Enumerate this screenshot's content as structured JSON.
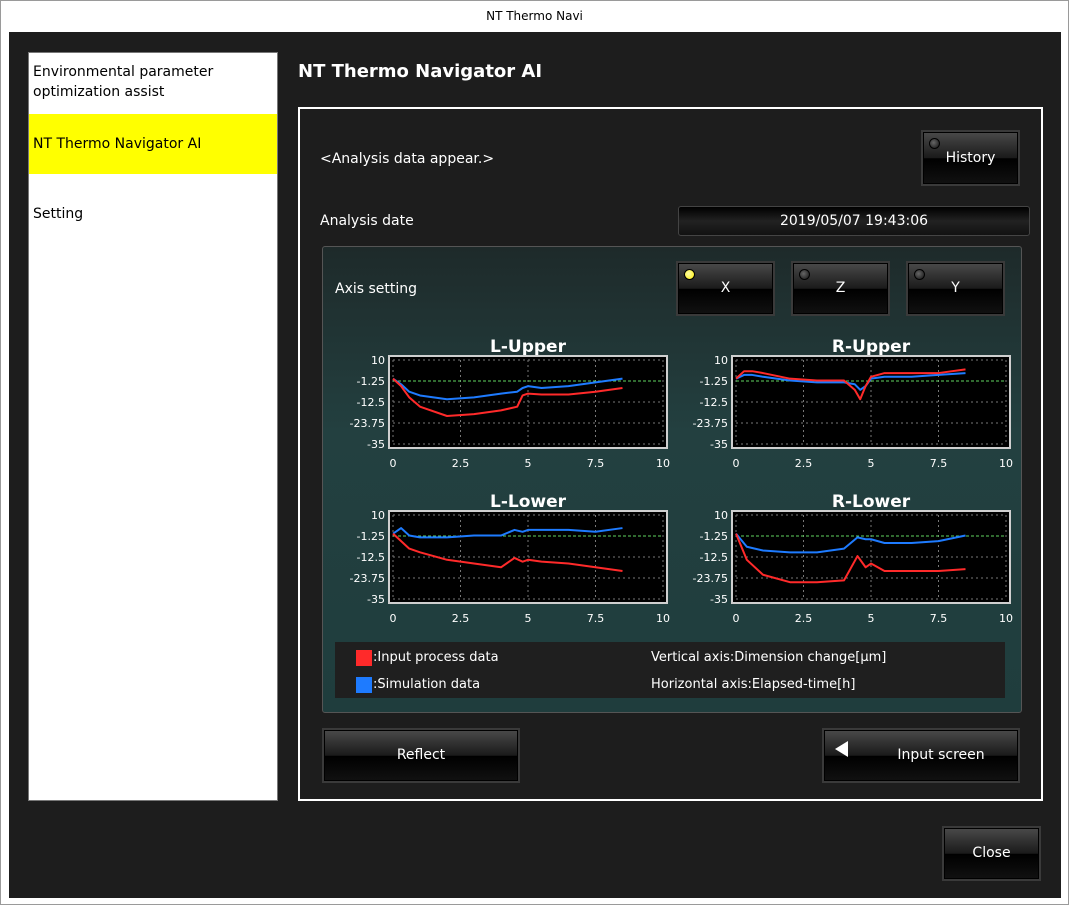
{
  "window": {
    "title": "NT Thermo Navi"
  },
  "sidebar": {
    "items": [
      {
        "label": "Environmental parameter optimization assist",
        "active": false
      },
      {
        "label": "NT Thermo Navigator AI",
        "active": true
      },
      {
        "label": "Setting",
        "active": false
      }
    ]
  },
  "main": {
    "title": "NT Thermo Navigator AI",
    "status_text": "<Analysis data appear.>",
    "history_button": "History",
    "analysis_date_label": "Analysis date",
    "analysis_date_value": "2019/05/07 19:43:06",
    "axis_setting_label": "Axis setting",
    "axis_buttons": [
      {
        "label": "X",
        "selected": true
      },
      {
        "label": "Z",
        "selected": false
      },
      {
        "label": "Y",
        "selected": false
      }
    ],
    "reflect_button": "Reflect",
    "input_screen_button": "Input screen"
  },
  "close_button": "Close",
  "legend": {
    "input_label": ":Input process data",
    "simulation_label": ":Simulation data",
    "vertical_axis": "Vertical axis:Dimension change[μm]",
    "horizontal_axis": "Horizontal axis:Elapsed-time[h]",
    "input_color": "#ff2a2a",
    "simulation_color": "#1e7bff"
  },
  "chart_data": [
    {
      "type": "line",
      "title": "L-Upper",
      "xlim": [
        0,
        10
      ],
      "ylim": [
        -35,
        10
      ],
      "xticks": [
        "0",
        "2.5",
        "5",
        "7.5",
        "10"
      ],
      "yticks": [
        "10",
        "-1.25",
        "-12.5",
        "-23.75",
        "-35"
      ],
      "reference_y": -1.25,
      "grid": true,
      "series": [
        {
          "name": "Input process data",
          "color": "#ff2a2a",
          "x": [
            0,
            0.3,
            0.6,
            1,
            2,
            3,
            4,
            4.6,
            4.8,
            5,
            5.5,
            6.5,
            7.5,
            8.5
          ],
          "y": [
            0,
            -4,
            -10,
            -15,
            -20,
            -19,
            -17,
            -15,
            -9,
            -8,
            -8.5,
            -8.5,
            -7,
            -5
          ]
        },
        {
          "name": "Simulation data",
          "color": "#1e7bff",
          "x": [
            0,
            0.3,
            0.6,
            1,
            2,
            3,
            4,
            4.6,
            4.8,
            5,
            5.5,
            6.5,
            7.5,
            8.5
          ],
          "y": [
            0,
            -3,
            -7,
            -9,
            -11,
            -10,
            -8,
            -7,
            -5,
            -4,
            -5,
            -4,
            -2,
            0
          ]
        }
      ]
    },
    {
      "type": "line",
      "title": "R-Upper",
      "xlim": [
        0,
        10
      ],
      "ylim": [
        -35,
        10
      ],
      "xticks": [
        "0",
        "2.5",
        "5",
        "7.5",
        "10"
      ],
      "yticks": [
        "10",
        "-1.25",
        "-12.5",
        "-23.75",
        "-35"
      ],
      "reference_y": -1.25,
      "grid": true,
      "series": [
        {
          "name": "Input process data",
          "color": "#ff2a2a",
          "x": [
            0,
            0.3,
            0.6,
            1,
            2,
            3,
            4,
            4.4,
            4.6,
            4.8,
            5,
            5.5,
            6.5,
            7.5,
            8.5
          ],
          "y": [
            0,
            4,
            4,
            3,
            0,
            -1,
            -1,
            -6,
            -11,
            -4,
            1,
            3,
            3,
            3,
            5
          ]
        },
        {
          "name": "Simulation data",
          "color": "#1e7bff",
          "x": [
            0,
            0.3,
            0.6,
            1,
            2,
            3,
            4,
            4.4,
            4.6,
            4.8,
            5,
            5.5,
            6.5,
            7.5,
            8.5
          ],
          "y": [
            0,
            2,
            2,
            1,
            -1,
            -2,
            -2,
            -3,
            -6,
            -4,
            0,
            1,
            1,
            2,
            3
          ]
        }
      ]
    },
    {
      "type": "line",
      "title": "L-Lower",
      "xlim": [
        0,
        10
      ],
      "ylim": [
        -35,
        10
      ],
      "xticks": [
        "0",
        "2.5",
        "5",
        "7.5",
        "10"
      ],
      "yticks": [
        "10",
        "-1.25",
        "-12.5",
        "-23.75",
        "-35"
      ],
      "reference_y": -1.25,
      "grid": true,
      "series": [
        {
          "name": "Input process data",
          "color": "#ff2a2a",
          "x": [
            0,
            0.3,
            0.6,
            1,
            2,
            3,
            4,
            4.5,
            4.8,
            5,
            5.5,
            6.5,
            7.5,
            8.5
          ],
          "y": [
            0,
            -4,
            -8,
            -10,
            -14,
            -16,
            -18,
            -13,
            -15,
            -14,
            -15,
            -16,
            -18,
            -20
          ]
        },
        {
          "name": "Simulation data",
          "color": "#1e7bff",
          "x": [
            0,
            0.3,
            0.6,
            1,
            2,
            3,
            4,
            4.5,
            4.8,
            5,
            5.5,
            6.5,
            7.5,
            8.5
          ],
          "y": [
            0,
            3,
            -1,
            -2,
            -2,
            -1,
            -1,
            2,
            1,
            2,
            2,
            2,
            1,
            3
          ]
        }
      ]
    },
    {
      "type": "line",
      "title": "R-Lower",
      "xlim": [
        0,
        10
      ],
      "ylim": [
        -35,
        10
      ],
      "xticks": [
        "0",
        "2.5",
        "5",
        "7.5",
        "10"
      ],
      "yticks": [
        "10",
        "-1.25",
        "-12.5",
        "-23.75",
        "-35"
      ],
      "reference_y": -1.25,
      "grid": true,
      "series": [
        {
          "name": "Input process data",
          "color": "#ff2a2a",
          "x": [
            0,
            0.4,
            1,
            2,
            3,
            4,
            4.5,
            4.8,
            5,
            5.5,
            6.5,
            7.5,
            8.5
          ],
          "y": [
            0,
            -14,
            -22,
            -26,
            -26,
            -25,
            -12,
            -18,
            -16,
            -20,
            -20,
            -20,
            -19
          ]
        },
        {
          "name": "Simulation data",
          "color": "#1e7bff",
          "x": [
            0,
            0.4,
            1,
            2,
            3,
            4,
            4.5,
            4.8,
            5,
            5.5,
            6.5,
            7.5,
            8.5
          ],
          "y": [
            0,
            -7,
            -9,
            -10,
            -10,
            -8,
            -2,
            -3,
            -3,
            -5,
            -5,
            -4,
            -1
          ]
        }
      ]
    }
  ]
}
